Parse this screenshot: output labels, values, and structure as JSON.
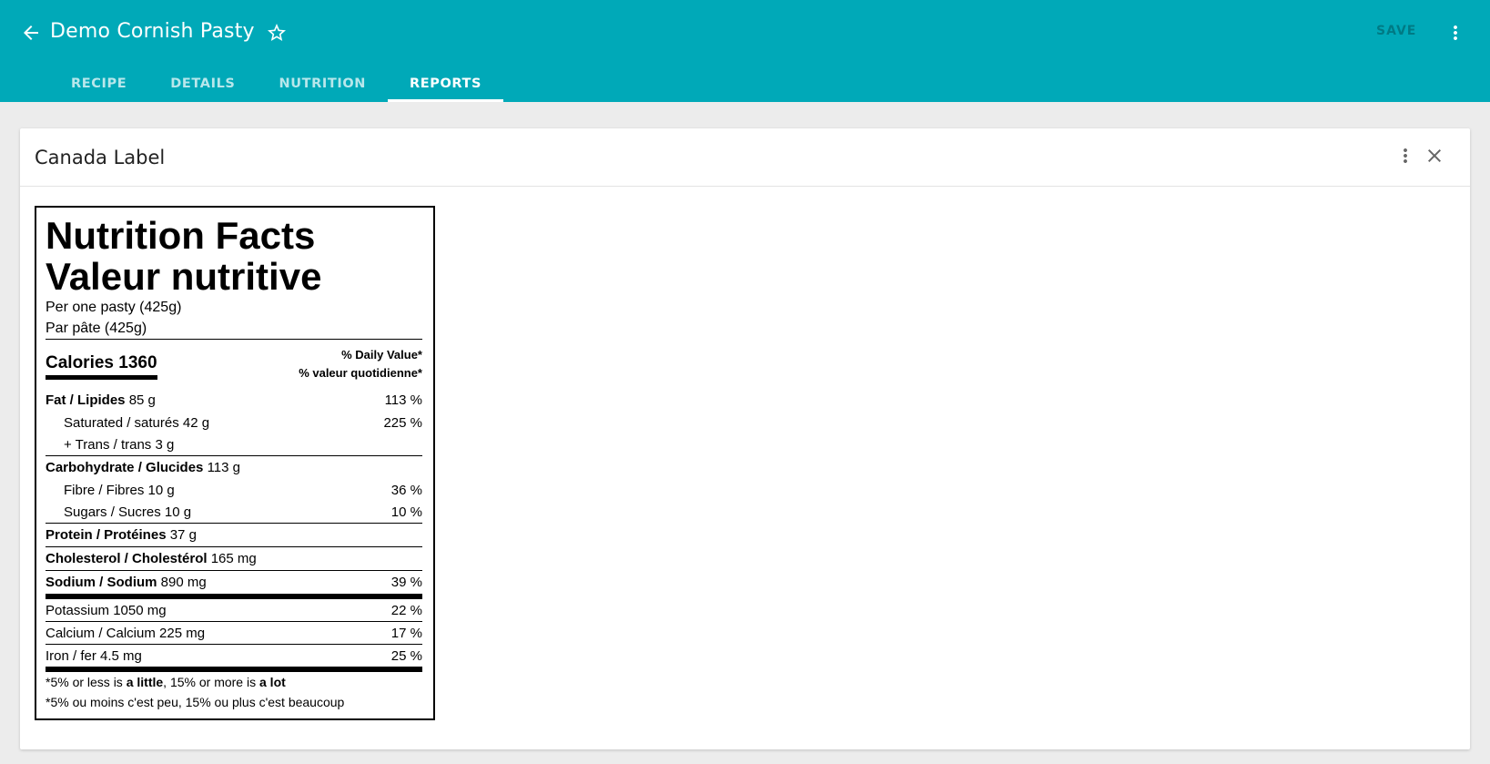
{
  "header": {
    "title": "Demo Cornish Pasty",
    "save_label": "SAVE",
    "tabs": [
      {
        "label": "RECIPE",
        "active": false
      },
      {
        "label": "DETAILS",
        "active": false
      },
      {
        "label": "NUTRITION",
        "active": false
      },
      {
        "label": "REPORTS",
        "active": true
      }
    ],
    "icons": [
      "arrow-back-icon",
      "star-outline-icon",
      "more-vert-icon"
    ],
    "colors": {
      "bar": "#00a9b8",
      "save_disabled": "rgba(0,0,0,0.28)"
    }
  },
  "card": {
    "title": "Canada Label",
    "icons": [
      "more-vert-icon",
      "close-icon"
    ]
  },
  "label": {
    "title_en": "Nutrition Facts",
    "title_fr": "Valeur nutritive",
    "serving_en": "Per one pasty (425g)",
    "serving_fr": "Par pâte (425g)",
    "calories": "Calories 1360",
    "dv_en": "% Daily Value*",
    "dv_fr": "% valeur quotidienne*",
    "fat": {
      "name": "Fat / Lipides",
      "amount": "85 g",
      "dv": "113 %"
    },
    "saturated": {
      "name": "Saturated / saturés",
      "amount": "42 g",
      "dv": "225 %"
    },
    "trans": {
      "name": "+ Trans / trans",
      "amount": "3 g"
    },
    "carbohydrate": {
      "name": "Carbohydrate / Glucides",
      "amount": "113 g"
    },
    "fibre": {
      "name": "Fibre / Fibres",
      "amount": "10 g",
      "dv": "36 %"
    },
    "sugars": {
      "name": "Sugars / Sucres",
      "amount": "10 g",
      "dv": "10 %"
    },
    "protein": {
      "name": "Protein / Protéines",
      "amount": "37 g"
    },
    "cholesterol": {
      "name": "Cholesterol / Cholestérol",
      "amount": "165 mg"
    },
    "sodium": {
      "name": "Sodium / Sodium",
      "amount": "890 mg",
      "dv": "39 %"
    },
    "potassium": {
      "name": "Potassium",
      "amount": "1050 mg",
      "dv": "22 %"
    },
    "calcium": {
      "name": "Calcium / Calcium",
      "amount": "225 mg",
      "dv": "17 %"
    },
    "iron": {
      "name": "Iron / fer",
      "amount": "4.5 mg",
      "dv": "25 %"
    },
    "footnote_en": {
      "p1": "*5% or less is ",
      "b1": "a little",
      "p2": ", 15% or more is ",
      "b2": "a lot"
    },
    "footnote_fr": "*5% ou moins c'est peu, 15% ou plus c'est beaucoup"
  }
}
